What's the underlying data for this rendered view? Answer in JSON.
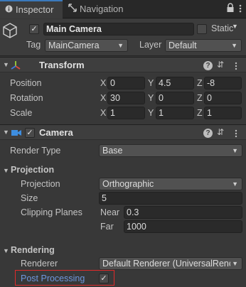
{
  "tabs": [
    {
      "label": "Inspector",
      "icon": "info-icon"
    },
    {
      "label": "Navigation",
      "icon": "navigation-icon"
    }
  ],
  "game_object": {
    "active": "✓",
    "name": "Main Camera",
    "static_label": "Static",
    "tag_label": "Tag",
    "tag_value": "MainCamera",
    "layer_label": "Layer",
    "layer_value": "Default"
  },
  "transform": {
    "title": "Transform",
    "position_label": "Position",
    "rotation_label": "Rotation",
    "scale_label": "Scale",
    "axis_labels": [
      "X",
      "Y",
      "Z"
    ],
    "position": [
      "0",
      "4.5",
      "-8"
    ],
    "rotation": [
      "30",
      "0",
      "0"
    ],
    "scale": [
      "1",
      "1",
      "1"
    ]
  },
  "camera": {
    "title": "Camera",
    "enabled": "✓",
    "render_type_label": "Render Type",
    "render_type_value": "Base",
    "projection_section": "Projection",
    "projection_label": "Projection",
    "projection_value": "Orthographic",
    "size_label": "Size",
    "size_value": "5",
    "clipping_label": "Clipping Planes",
    "near_label": "Near",
    "near_value": "0.3",
    "far_label": "Far",
    "far_value": "1000",
    "rendering_section": "Rendering",
    "renderer_label": "Renderer",
    "renderer_value": "Default Renderer (UniversalRenc",
    "post_processing_label": "Post Processing",
    "post_processing_checked": "✓"
  },
  "colors": {
    "accent": "#3a79bb",
    "highlight_box": "#e02a2a",
    "post_processing_label": "#6d97de"
  }
}
